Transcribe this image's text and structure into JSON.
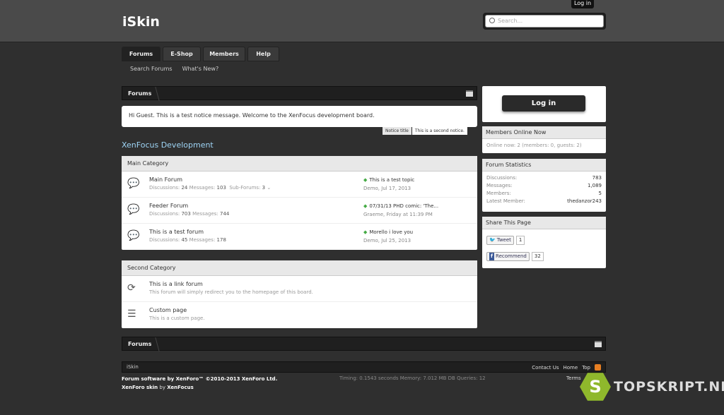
{
  "header": {
    "logo": "iSkin",
    "top_login": "Log in",
    "search_placeholder": "Search..."
  },
  "nav": {
    "tabs": [
      "Forums",
      "E-Shop",
      "Members",
      "Help"
    ],
    "sub": [
      "Search Forums",
      "What's New?"
    ]
  },
  "breadcrumb": "Forums",
  "notice": {
    "text": "Hi Guest. This is a test notice message. Welcome to the XenFocus development board.",
    "tabs": [
      "Notice title",
      "This is a second notice."
    ]
  },
  "section_title": "XenFocus Development",
  "categories": [
    {
      "name": "Main Category",
      "forums": [
        {
          "title": "Main Forum",
          "discussions": "24",
          "messages": "103",
          "subforums": "3",
          "last_title": "This is a test topic",
          "last_meta": "Demo, Jul 17, 2013"
        },
        {
          "title": "Feeder Forum",
          "discussions": "703",
          "messages": "744",
          "last_title": "07/31/13 PHD comic: 'The...",
          "last_meta": "Graeme, Friday at 11:39 PM"
        },
        {
          "title": "This is a test forum",
          "discussions": "45",
          "messages": "178",
          "last_title": "Morello i love you",
          "last_meta": "Demo, Jul 25, 2013"
        }
      ]
    },
    {
      "name": "Second Category",
      "forums": [
        {
          "title": "This is a link forum",
          "desc": "This forum will simply redirect you to the homepage of this board."
        },
        {
          "title": "Custom page",
          "desc": "This is a custom page."
        }
      ]
    }
  ],
  "labels": {
    "discussions": "Discussions:",
    "messages": "Messages:",
    "subforums": "Sub-Forums:"
  },
  "sidebar": {
    "login": "Log in",
    "online_title": "Members Online Now",
    "online_text": "Online now: 2 (members: 0, guests: 2)",
    "stats_title": "Forum Statistics",
    "stats": [
      {
        "label": "Discussions:",
        "value": "783"
      },
      {
        "label": "Messages:",
        "value": "1,089"
      },
      {
        "label": "Members:",
        "value": "5"
      },
      {
        "label": "Latest Member:",
        "value": "thedanzor243"
      }
    ],
    "share_title": "Share This Page",
    "tweet": "Tweet",
    "tweet_count": "1",
    "recommend": "Recommend",
    "recommend_count": "32"
  },
  "footer": {
    "brand": "iSkin",
    "links": [
      "Contact Us",
      "Home",
      "Top"
    ],
    "legal1": "Forum software by XenForo™ ©2010-2013 XenForo Ltd.",
    "legal2_a": "XenForo skin",
    "legal2_by": "by",
    "legal2_b": "XenFocus",
    "debug": "Timing: 0.1543 seconds Memory: 7.012 MB DB Queries: 12",
    "terms": "Terms"
  },
  "watermark": {
    "letter": "S",
    "text": "TOPSKRIPT.NET"
  }
}
